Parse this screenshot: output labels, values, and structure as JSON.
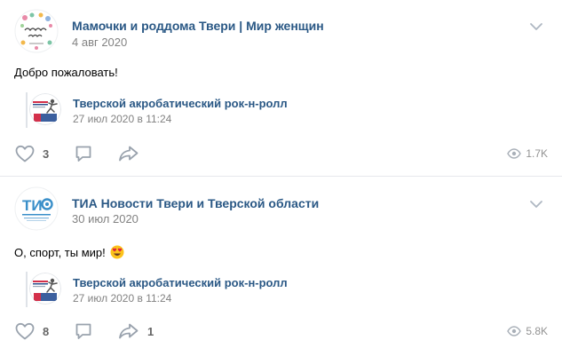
{
  "posts": [
    {
      "author": "Мамочки и роддома Твери | Мир женщин",
      "date": "4 авг 2020",
      "text": "Добро пожаловать!",
      "avatar_icon": "mamochki-logo-icon",
      "repost": {
        "name": "Тверской акробатический рок-н-ролл",
        "date": "27 июл 2020 в 11:24"
      },
      "likes": "3",
      "shares": "",
      "views": "1.7K"
    },
    {
      "author": "ТИА Новости Твери и Тверской области",
      "date": "30 июл 2020",
      "text": "О, спорт, ты мир!",
      "text_emoji": "heart-eyes-emoji",
      "avatar_icon": "tia-logo-icon",
      "repost": {
        "name": "Тверской акробатический рок-н-ролл",
        "date": "27 июл 2020 в 11:24"
      },
      "likes": "8",
      "shares": "1",
      "views": "5.8K"
    }
  ],
  "colors": {
    "link": "#2a5885",
    "secondary": "#828282",
    "icon": "#99a2ad",
    "divider": "#e7e8ec"
  }
}
